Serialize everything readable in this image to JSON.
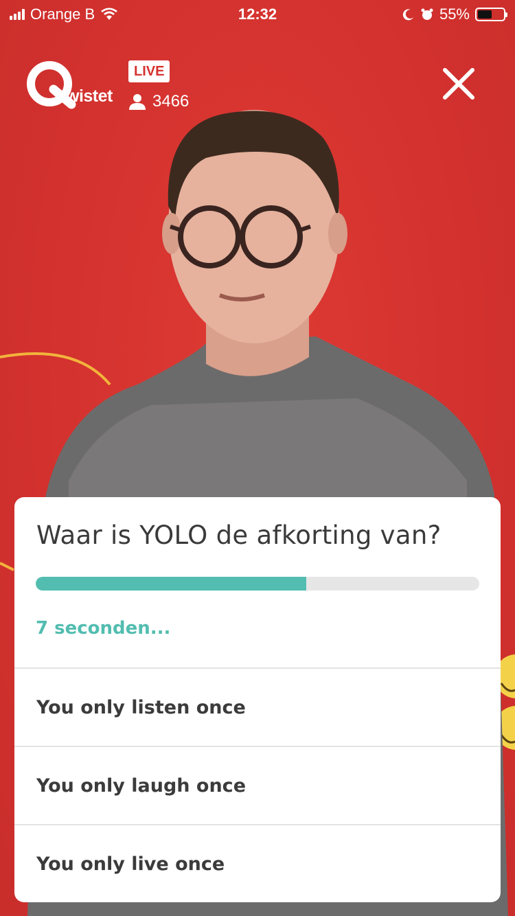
{
  "status_bar": {
    "carrier": "Orange B",
    "time": "12:32",
    "battery": "55%",
    "battery_level": 0.55
  },
  "stream": {
    "brand": "Qwistet",
    "live_label": "LIVE",
    "viewer_count": "3466"
  },
  "quiz": {
    "question": "Waar is YOLO de afkorting van?",
    "progress": 0.61,
    "timer_text": "7 seconden...",
    "answers": [
      {
        "label": "You only listen once"
      },
      {
        "label": "You only laugh once"
      },
      {
        "label": "You only live once"
      }
    ]
  },
  "colors": {
    "background": "#d6322f",
    "accent": "#52bdb0",
    "card": "#ffffff"
  }
}
